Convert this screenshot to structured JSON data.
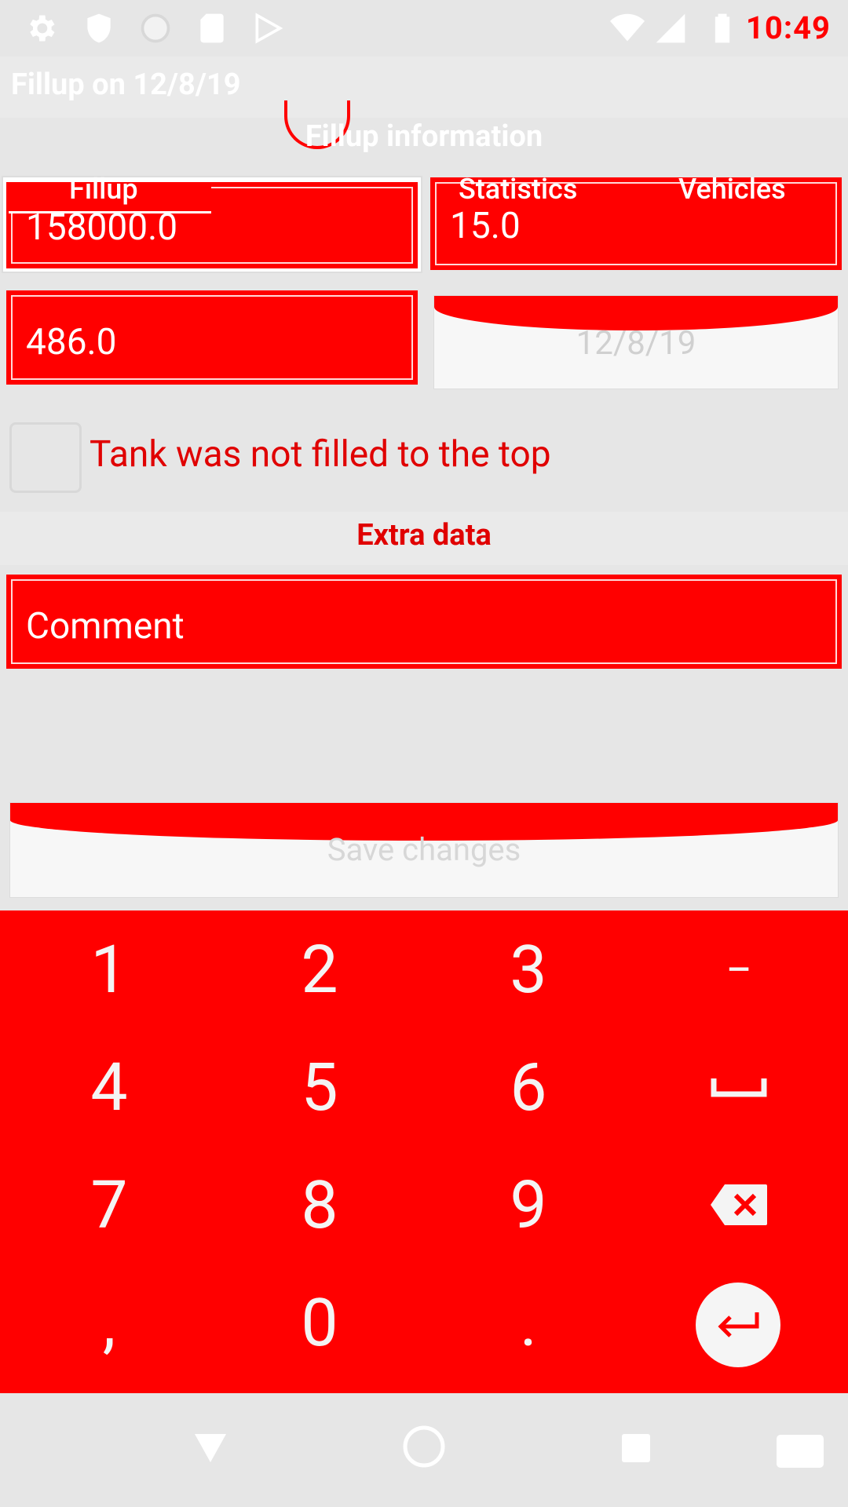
{
  "status_bar": {
    "time": "10:49"
  },
  "app_bar": {
    "title": "Fillup on 12/8/19"
  },
  "sections": {
    "fillup_info": "Fillup information",
    "extra_data": "Extra data"
  },
  "tabs": [
    "Fillup",
    "Statistics",
    "Vehicles"
  ],
  "fields": {
    "odometer": "158000.0",
    "volume": "15.0",
    "price": "486.0",
    "date": "12/8/19",
    "comment": "Comment"
  },
  "checkbox": {
    "label": "Tank was not filled to the top",
    "checked": false
  },
  "save_button": "Save changes",
  "keypad": {
    "rows": [
      [
        "1",
        "2",
        "3",
        "−"
      ],
      [
        "4",
        "5",
        "6",
        "␣"
      ],
      [
        "7",
        "8",
        "9",
        "⌫"
      ],
      [
        ",",
        "0",
        ".",
        "↵"
      ]
    ]
  },
  "colors": {
    "accent": "#ff0000",
    "background": "#e6e6e6"
  }
}
